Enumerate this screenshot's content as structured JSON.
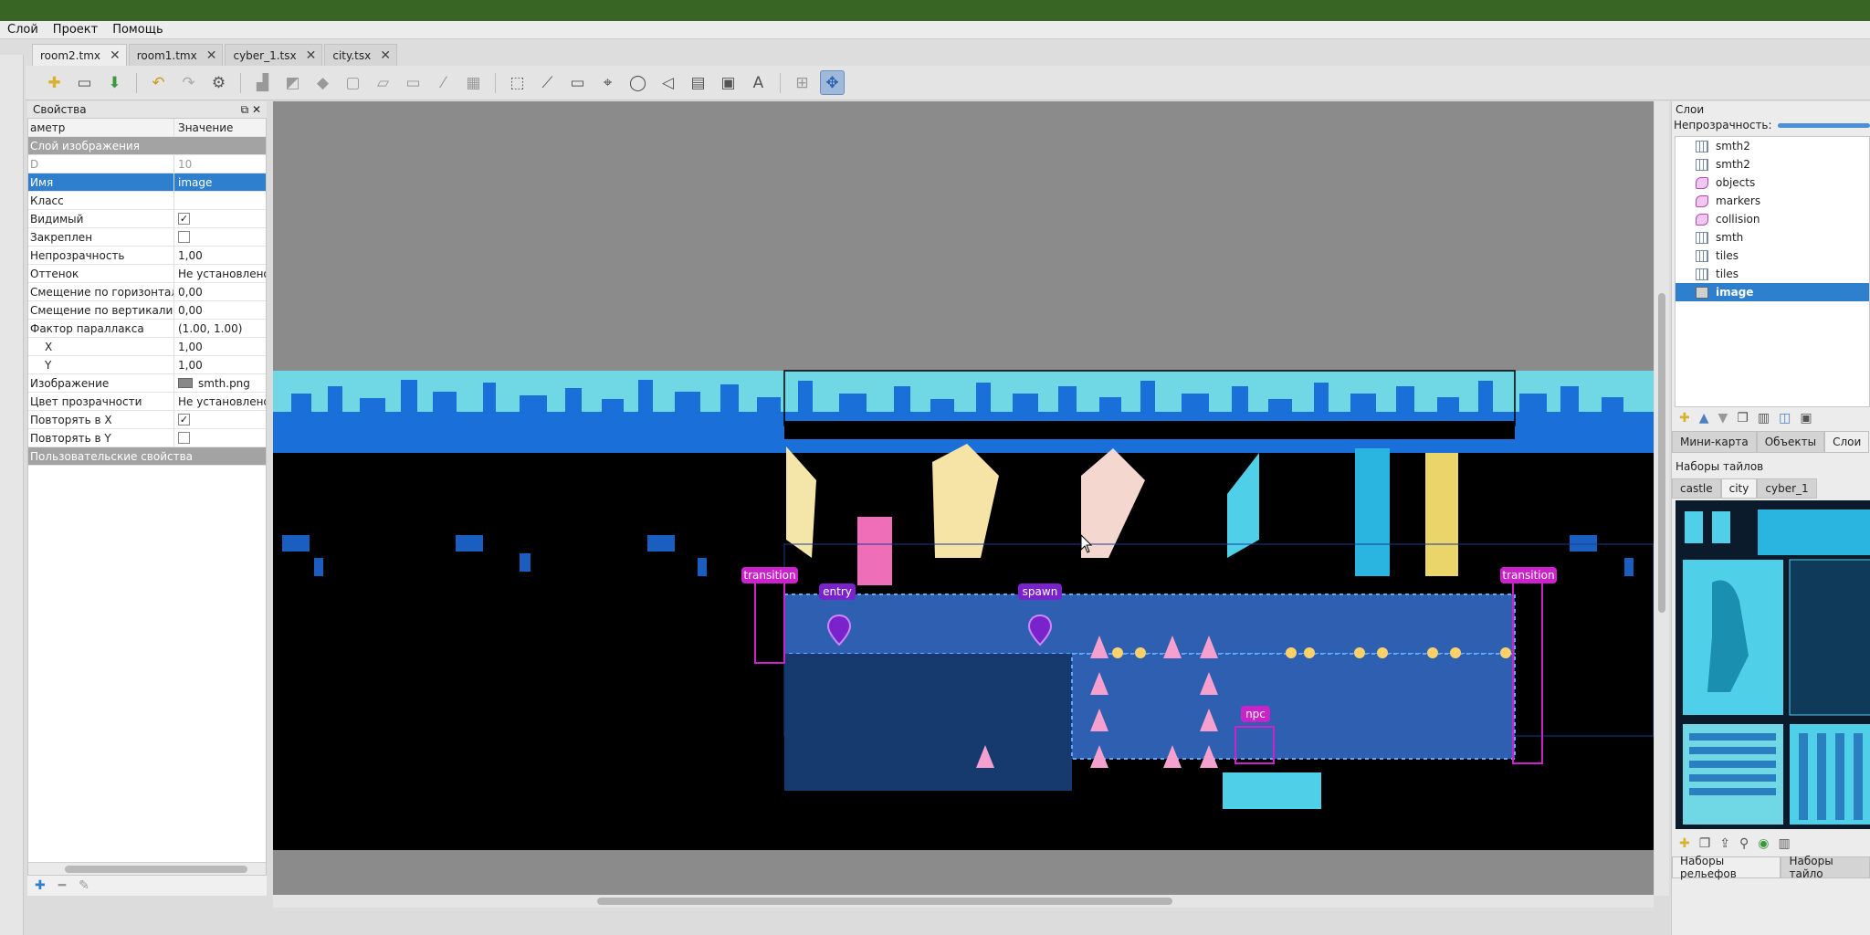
{
  "menu": [
    "Слой",
    "Проект",
    "Помощь"
  ],
  "tabs": [
    {
      "label": "room2.tmx",
      "active": true
    },
    {
      "label": "room1.tmx",
      "active": false
    },
    {
      "label": "cyber_1.tsx",
      "active": false
    },
    {
      "label": "city.tsx",
      "active": false
    }
  ],
  "tab_close": "✕",
  "props": {
    "title": "Свойства",
    "col_name": "аметр",
    "col_value": "Значение",
    "group": "Слой изображения",
    "rows": [
      {
        "name": "D",
        "value": "10",
        "kind": "dim"
      },
      {
        "name": "Имя",
        "value": "image",
        "kind": "sel"
      },
      {
        "name": "Класс",
        "value": "",
        "kind": "text"
      },
      {
        "name": "Видимый",
        "value": "✓",
        "kind": "check"
      },
      {
        "name": "Закреплен",
        "value": "",
        "kind": "check"
      },
      {
        "name": "Непрозрачность",
        "value": "1,00",
        "kind": "text"
      },
      {
        "name": "Оттенок",
        "value": "Не установлено",
        "kind": "text"
      },
      {
        "name": "Смещение по горизонтали",
        "value": "0,00",
        "kind": "text"
      },
      {
        "name": "Смещение по вертикали",
        "value": "0,00",
        "kind": "text"
      },
      {
        "name": "Фактор параллакса",
        "value": "(1.00, 1.00)",
        "kind": "text"
      },
      {
        "name": "X",
        "value": "1,00",
        "kind": "sub"
      },
      {
        "name": "Y",
        "value": "1,00",
        "kind": "sub"
      },
      {
        "name": "Изображение",
        "value": "smth.png",
        "kind": "image"
      },
      {
        "name": "Цвет прозрачности",
        "value": "Не установлено",
        "kind": "text"
      },
      {
        "name": "Повторять в X",
        "value": "✓",
        "kind": "check"
      },
      {
        "name": "Повторять в Y",
        "value": "",
        "kind": "check"
      }
    ],
    "custom_group": "Пользовательские свойства"
  },
  "map_labels": {
    "transition_left": "transition",
    "entry": "entry",
    "spawn": "spawn",
    "transition_right": "transition",
    "npc": "npc"
  },
  "layers": {
    "title": "Слои",
    "opacity_label": "Непрозрачность:",
    "items": [
      {
        "name": "smth2",
        "type": "tile"
      },
      {
        "name": "smth2",
        "type": "tile"
      },
      {
        "name": "objects",
        "type": "obj"
      },
      {
        "name": "markers",
        "type": "obj"
      },
      {
        "name": "collision",
        "type": "obj"
      },
      {
        "name": "smth",
        "type": "tile"
      },
      {
        "name": "tiles",
        "type": "tile"
      },
      {
        "name": "tiles",
        "type": "tile"
      },
      {
        "name": "image",
        "type": "img",
        "selected": true
      }
    ]
  },
  "right_tabs": [
    "Мини-карта",
    "Объекты",
    "Слои"
  ],
  "tilesets": {
    "title": "Наборы тайлов",
    "tabs": [
      "castle",
      "city",
      "cyber_1"
    ],
    "active": "city"
  },
  "bottom_tabs": [
    "Наборы рельефов",
    "Наборы тайло"
  ],
  "colors": {
    "accent": "#2f7fcf",
    "sky": "#6fd8e4",
    "city_blue": "#1a6fd8",
    "room_blue": "#2f5fb0",
    "marker_magenta": "#cc22cc",
    "titlebar_green": "#396524"
  }
}
